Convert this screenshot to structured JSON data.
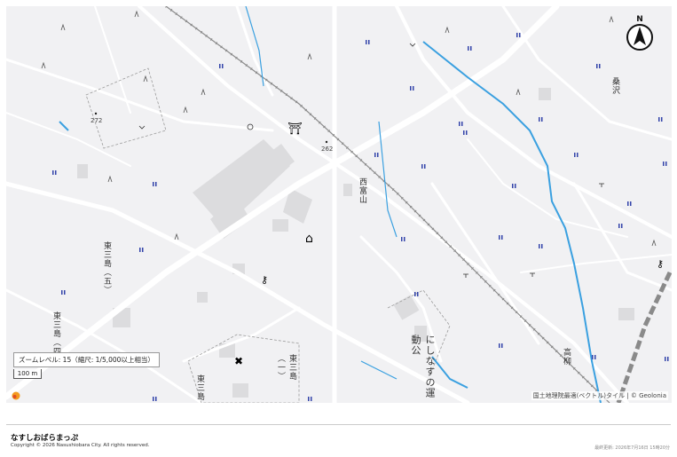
{
  "map": {
    "place_labels": [
      {
        "key": "nishitomiyama",
        "text": "西富山"
      },
      {
        "key": "higashimishima5",
        "text": "東三島（五）"
      },
      {
        "key": "higashimishima4",
        "text": "東三島（四"
      },
      {
        "key": "higashimishima1",
        "text": "東三島（一）"
      },
      {
        "key": "higashimishima",
        "text": "東三島"
      },
      {
        "key": "undo",
        "text": "にしなすの運動公"
      },
      {
        "key": "takayanagi",
        "text": "高柳"
      },
      {
        "key": "kuwahara",
        "text": "桑沢"
      }
    ],
    "spot_heights": [
      {
        "key": "h272",
        "text": "272"
      },
      {
        "key": "h262",
        "text": "262"
      }
    ],
    "zoom_label": "ズームレベル: 15（縮尺: 1/5,000以上相当）",
    "scale_label": "100 m",
    "attribution": "国土地理院最適(ベクトル)タイル | © Geolonia",
    "north_label": "N",
    "colors": {
      "road": "#ffffff",
      "building": "#dcdcde",
      "water": "#3aa0e0",
      "rail": "#8a8a8a",
      "background": "#f1f1f3"
    }
  },
  "footer": {
    "site_title": "なすしおばらまっぷ",
    "copyright": "Copyright © 2026 Nasushiobara City. All rights reserved.",
    "updated": "最終更新: 2026年7月16日 15時20分"
  }
}
